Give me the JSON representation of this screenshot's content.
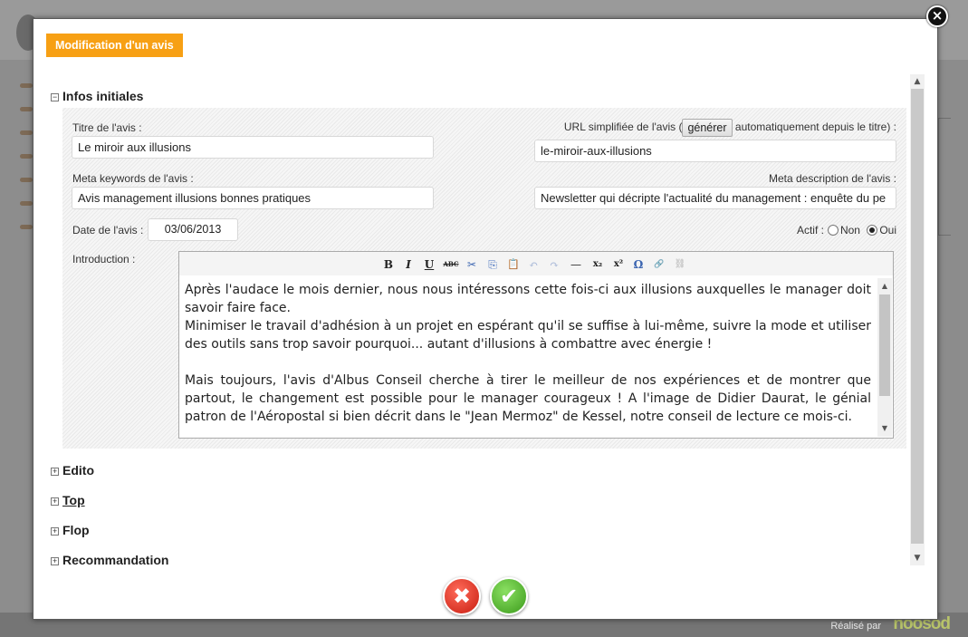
{
  "background": {
    "footer_credit": "Réalisé par",
    "footer_brand": "noosod"
  },
  "modal": {
    "title": "Modification d'un avis",
    "close_label": "×",
    "cancel_label": "✖",
    "ok_label": "✔"
  },
  "sections": {
    "infos": {
      "toggle": "−",
      "label": "Infos initiales"
    },
    "edito": {
      "toggle": "+",
      "label": "Edito"
    },
    "top": {
      "toggle": "+",
      "label": "Top"
    },
    "flop": {
      "toggle": "+",
      "label": "Flop"
    },
    "recommandation": {
      "toggle": "+",
      "label": "Recommandation"
    }
  },
  "form": {
    "titre_label": "Titre de l'avis :",
    "titre_value": "Le miroir aux illusions",
    "url_label_before": "URL simplifiée de l'avis (",
    "url_button": "générer",
    "url_label_after": "automatiquement depuis le titre) :",
    "url_value": "le-miroir-aux-illusions",
    "keywords_label": "Meta keywords de l'avis :",
    "keywords_value": "Avis management illusions bonnes pratiques",
    "description_label": "Meta description de l'avis :",
    "description_value": "Newsletter qui décripte l'actualité du management : enquête du pe",
    "date_label": "Date de l'avis :",
    "date_value": "03/06/2013",
    "actif_label": "Actif :",
    "actif_non": "Non",
    "actif_oui": "Oui",
    "actif_selected": "Oui",
    "intro_label": "Introduction :"
  },
  "editor": {
    "toolbar": {
      "bold": "B",
      "italic": "I",
      "underline": "U",
      "strike": "ABC",
      "cut": "✂",
      "copy": "⎘",
      "paste": "📋",
      "undo": "↶",
      "redo": "↷",
      "hr": "—",
      "subscript": "x₂",
      "superscript": "x²",
      "special_char": "Ω",
      "link": "🔗",
      "unlink": "⛓"
    },
    "paragraphs": [
      "Après l'audace le mois dernier, nous nous intéressons cette fois-ci aux illusions auxquelles le manager doit savoir faire face.",
      "Minimiser le travail d'adhésion à un projet en espérant qu'il se suffise à lui-même, suivre la mode et utiliser des outils sans trop savoir pourquoi... autant d'illusions à combattre avec énergie !",
      "Mais toujours, l'avis d'Albus Conseil cherche à tirer le meilleur de nos expériences et de montrer que partout, le changement est possible pour le manager courageux ! A l'image de Didier Daurat, le génial patron de l'Aéropostal si bien décrit dans le \"Jean Mermoz\" de Kessel, notre conseil de lecture ce mois-ci."
    ]
  },
  "scrollbar": {
    "up": "▲",
    "down": "▼"
  }
}
